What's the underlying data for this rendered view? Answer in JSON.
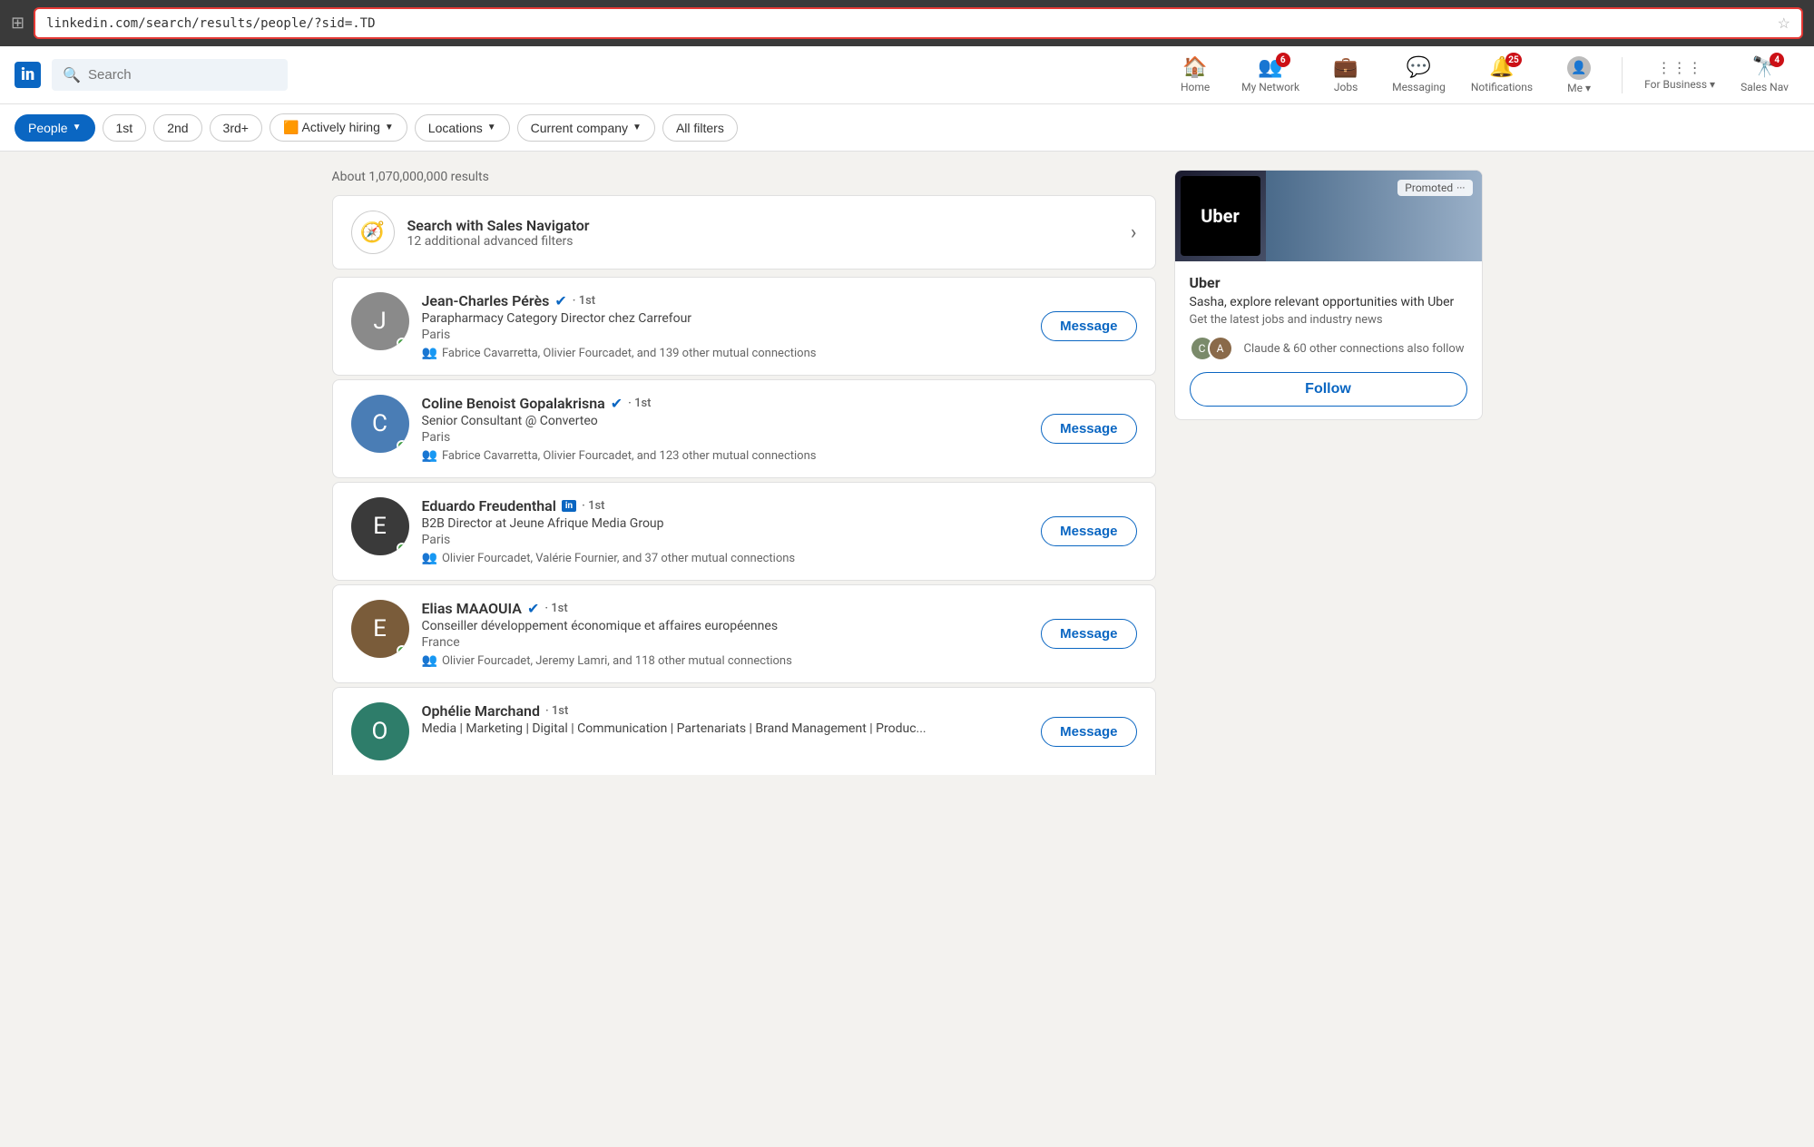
{
  "addressBar": {
    "url": "linkedin.com/search/results/people/?sid=.TD"
  },
  "nav": {
    "logo": "in",
    "search": {
      "placeholder": "Search"
    },
    "items": [
      {
        "id": "home",
        "label": "Home",
        "icon": "🏠",
        "badge": null
      },
      {
        "id": "my-network",
        "label": "My Network",
        "icon": "👥",
        "badge": "6"
      },
      {
        "id": "jobs",
        "label": "Jobs",
        "icon": "💼",
        "badge": null
      },
      {
        "id": "messaging",
        "label": "Messaging",
        "icon": "💬",
        "badge": null
      },
      {
        "id": "notifications",
        "label": "Notifications",
        "icon": "🔔",
        "badge": "25"
      },
      {
        "id": "me",
        "label": "Me ▾",
        "icon": "👤",
        "badge": null
      },
      {
        "id": "for-business",
        "label": "For Business ▾",
        "icon": "⋮⋮⋮",
        "badge": null
      },
      {
        "id": "sales-nav",
        "label": "Sales Nav",
        "icon": "🔭",
        "badge": "4"
      }
    ]
  },
  "filters": {
    "people": "People",
    "first": "1st",
    "second": "2nd",
    "thirdPlus": "3rd+",
    "activelyHiring": "🟧 Actively hiring",
    "locations": "Locations",
    "currentCompany": "Current company",
    "allFilters": "All filters"
  },
  "results": {
    "count": "About 1,070,000,000 results",
    "salesNav": {
      "title": "Search with Sales Navigator",
      "subtitle": "12 additional advanced filters"
    },
    "people": [
      {
        "name": "Jean-Charles Pérès",
        "verified": true,
        "degree": "1st",
        "title": "Parapharmacy Category Director chez Carrefour",
        "location": "Paris",
        "mutual": "Fabrice Cavarretta, Olivier Fourcadet, and 139 other mutual connections",
        "avatarColor": "av-gray",
        "avatarLetter": "J",
        "online": true,
        "hasInBadge": false
      },
      {
        "name": "Coline Benoist Gopalakrisna",
        "verified": true,
        "degree": "1st",
        "title": "Senior Consultant @ Converteo",
        "location": "Paris",
        "mutual": "Fabrice Cavarretta, Olivier Fourcadet, and 123 other mutual connections",
        "avatarColor": "av-blue",
        "avatarLetter": "C",
        "online": true,
        "hasInBadge": false
      },
      {
        "name": "Eduardo Freudenthal",
        "verified": false,
        "degree": "1st",
        "title": "B2B Director at Jeune Afrique Media Group",
        "location": "Paris",
        "mutual": "Olivier Fourcadet, Valérie Fournier, and 37 other mutual connections",
        "avatarColor": "av-dark",
        "avatarLetter": "E",
        "online": true,
        "hasInBadge": true
      },
      {
        "name": "Elias MAAOUIA",
        "verified": true,
        "degree": "1st",
        "title": "Conseiller développement économique et affaires européennes",
        "location": "France",
        "mutual": "Olivier Fourcadet, Jeremy Lamri, and 118 other mutual connections",
        "avatarColor": "av-brown",
        "avatarLetter": "E",
        "online": true,
        "hasInBadge": false
      },
      {
        "name": "Ophélie Marchand",
        "verified": false,
        "degree": "1st",
        "title": "Media | Marketing | Digital | Communication | Partenariats | Brand Management | Produc...",
        "location": "",
        "mutual": "",
        "avatarColor": "av-teal",
        "avatarLetter": "O",
        "online": false,
        "hasInBadge": false
      }
    ],
    "messageBtn": "Message"
  },
  "ad": {
    "promoted": "Promoted",
    "company": "Uber",
    "tagline": "Sasha, explore relevant opportunities with Uber",
    "sub": "Get the latest jobs and industry news",
    "connections": "Claude & 60 other connections also follow",
    "followBtn": "Follow"
  }
}
